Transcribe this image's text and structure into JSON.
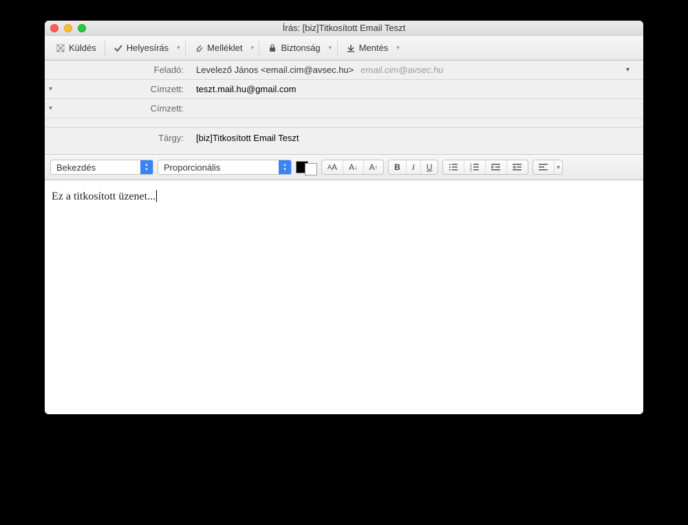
{
  "window": {
    "title": "Írás: [biz]Titkosított Email Teszt"
  },
  "toolbar": {
    "send": "Küldés",
    "spell": "Helyesírás",
    "attach": "Melléklet",
    "security": "Biztonság",
    "save": "Mentés"
  },
  "headers": {
    "from_label": "Feladó:",
    "from_value": "Levelező János <email.cim@avsec.hu>",
    "from_hint": "email.cim@avsec.hu",
    "to_label": "Címzett:",
    "to_value": "teszt.mail.hu@gmail.com",
    "to2_label": "Címzett:",
    "to2_value": "",
    "subject_label": "Tárgy:",
    "subject_value": "[biz]Titkosított Email Teszt"
  },
  "format": {
    "paragraph": "Bekezdés",
    "font": "Proporcionális",
    "color_fg": "#000000",
    "color_bg": "#ffffff"
  },
  "body": {
    "text": "Ez a titkosított üzenet..."
  }
}
